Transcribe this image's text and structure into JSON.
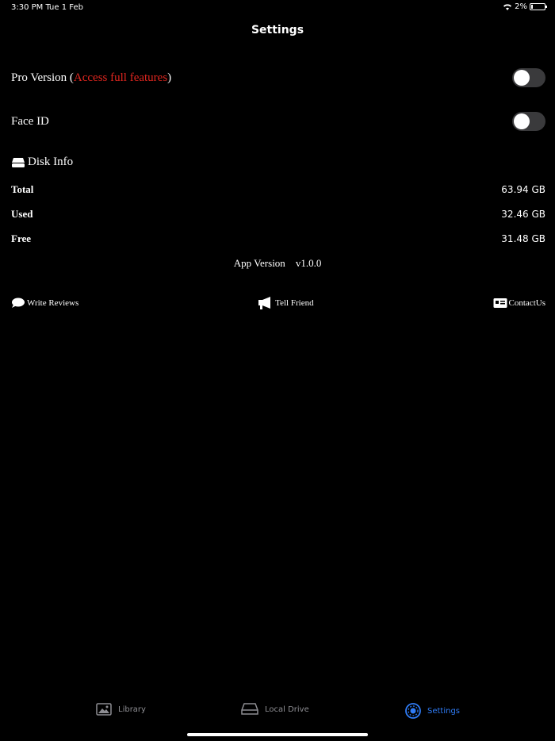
{
  "status_bar": {
    "time": "3:30 PM  Tue 1 Feb",
    "battery": "2%"
  },
  "nav": {
    "title": "Settings"
  },
  "settings": {
    "pro_version": {
      "label": "Pro Version (",
      "accent": "Access full features",
      "suffix": ")",
      "enabled": false
    },
    "face_id": {
      "label": "Face ID",
      "enabled": false
    }
  },
  "disk_info": {
    "title": "Disk Info",
    "rows": [
      {
        "label": "Total",
        "value": "63.94 GB"
      },
      {
        "label": "Used",
        "value": "32.46 GB"
      },
      {
        "label": "Free",
        "value": "31.48 GB"
      }
    ]
  },
  "app_version": {
    "label": "App Version",
    "value": "v1.0.0"
  },
  "actions": {
    "write_reviews": "Write Reviews",
    "tell_friend": "Tell Friend",
    "contact_us": "ContactUs"
  },
  "tabs": [
    {
      "label": "Library",
      "icon": "photo-icon",
      "active": false
    },
    {
      "label": "Local Drive",
      "icon": "drive-icon",
      "active": false
    },
    {
      "label": "Settings",
      "icon": "settings-icon",
      "active": true
    }
  ],
  "colors": {
    "accent": "#e0261f",
    "active_tab": "#2f7cf6"
  }
}
